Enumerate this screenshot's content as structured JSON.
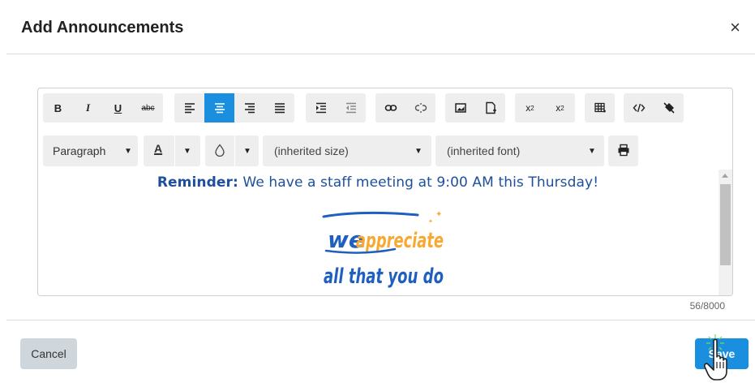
{
  "modal": {
    "title": "Add Announcements",
    "close_icon": "close-icon",
    "close_glyph": "×"
  },
  "toolbar": {
    "row1": {
      "bold": "B",
      "italic": "I",
      "underline": "U",
      "strikethrough": "abc",
      "align_left_icon": "align-left-icon",
      "align_center_icon": "align-center-icon",
      "align_right_icon": "align-right-icon",
      "align_justify_icon": "align-justify-icon",
      "indent_icon": "indent-icon",
      "outdent_icon": "outdent-icon",
      "link_icon": "link-icon",
      "unlink_icon": "unlink-icon",
      "image_icon": "image-icon",
      "file_icon": "file-icon",
      "subscript": "x",
      "subscript_mark": "2",
      "superscript": "x",
      "superscript_mark": "2",
      "table_icon": "table-icon",
      "code_icon": "code-icon",
      "clear_format_icon": "clear-format-icon"
    },
    "row2": {
      "paragraph": "Paragraph",
      "font_color_label": "A",
      "bg_color_icon": "droplet-icon",
      "font_size": "(inherited size)",
      "font_family": "(inherited font)",
      "print_icon": "print-icon"
    },
    "active_button": "align-center"
  },
  "content": {
    "reminder_label": "Reminder:",
    "reminder_text": " We have a staff meeting at 9:00 AM this Thursday!",
    "graphic_line1_a": "we",
    "graphic_line1_b": "appreciate",
    "graphic_line2": "all that you do"
  },
  "counter": "56/8000",
  "footer": {
    "cancel_label": "Cancel",
    "save_label": "Save"
  },
  "colors": {
    "accent": "#1a8fe0",
    "reminder_text": "#1d4f9c",
    "graphic_blue": "#1f5fbf",
    "graphic_orange": "#f7a932",
    "cancel_bg": "#cfd6dc"
  }
}
